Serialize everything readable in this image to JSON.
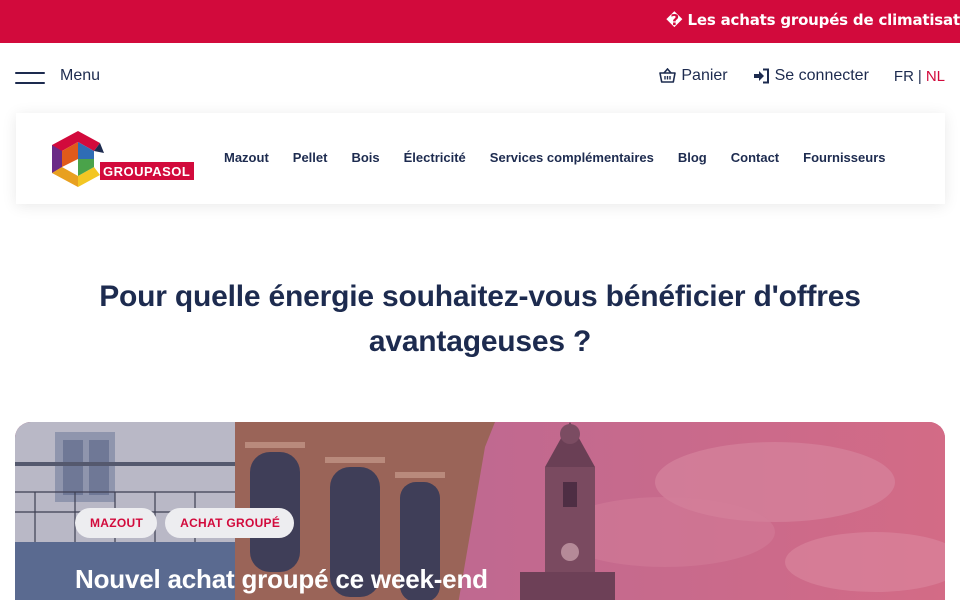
{
  "banner": {
    "text": "� Les achats groupés de climatisatio"
  },
  "utility": {
    "menu_label": "Menu",
    "cart_label": "Panier",
    "login_label": "Se connecter",
    "lang_fr": "FR",
    "lang_sep": "|",
    "lang_nl": "NL"
  },
  "logo": {
    "text": "GROUPASOL"
  },
  "nav": {
    "items": [
      "Mazout",
      "Pellet",
      "Bois",
      "Électricité",
      "Services complémentaires",
      "Blog",
      "Contact",
      "Fournisseurs"
    ]
  },
  "headline": {
    "line1": "Pour quelle énergie souhaitez-vous bénéficier d'offres",
    "line2": "avantageuses ?"
  },
  "hero": {
    "tags": [
      "MAZOUT",
      "ACHAT GROUPÉ"
    ],
    "title": "Nouvel achat groupé ce week-end"
  },
  "colors": {
    "accent": "#d20a3c",
    "navy": "#1d2b4f",
    "tag_bg": "#ededf0"
  },
  "icons": {
    "cart": "basket-icon",
    "login": "sign-in-icon",
    "menu": "hamburger-icon"
  }
}
